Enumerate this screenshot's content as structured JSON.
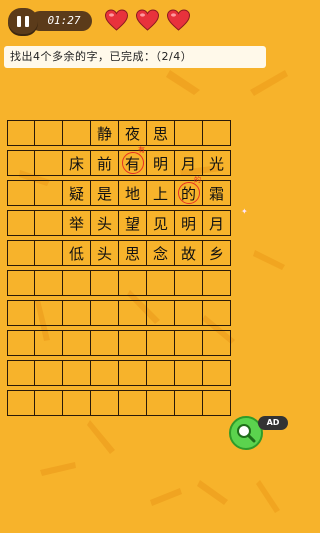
{
  "status_bar": {
    "timer": "01:27",
    "lives": 3
  },
  "instruction": "找出4个多余的字，已完成：（2/4）",
  "poem_grid": {
    "rows": [
      [
        "",
        "",
        "",
        "静",
        "夜",
        "思",
        "",
        ""
      ],
      [
        "",
        "",
        "床",
        "前",
        "有",
        "明",
        "月",
        "光"
      ],
      [
        "",
        "",
        "疑",
        "是",
        "地",
        "上",
        "的",
        "霜"
      ],
      [
        "",
        "",
        "举",
        "头",
        "望",
        "见",
        "明",
        "月"
      ],
      [
        "",
        "",
        "低",
        "头",
        "思",
        "念",
        "故",
        "乡"
      ],
      [
        "",
        "",
        "",
        "",
        "",
        "",
        "",
        ""
      ],
      [
        "",
        "",
        "",
        "",
        "",
        "",
        "",
        ""
      ],
      [
        "",
        "",
        "",
        "",
        "",
        "",
        "",
        ""
      ],
      [
        "",
        "",
        "",
        "",
        "",
        "",
        "",
        ""
      ],
      [
        "",
        "",
        "",
        "",
        "",
        "",
        "",
        ""
      ]
    ],
    "found_marks": [
      {
        "row": 1,
        "col": 4,
        "hint": "有"
      },
      {
        "row": 2,
        "col": 6,
        "hint": "的"
      }
    ]
  },
  "ad_badge": "AD",
  "colors": {
    "background": "#f7b32b",
    "accent_red": "#e53222",
    "button_dark": "#5b3b1a",
    "zoom_green": "#5bd34e"
  },
  "icons": {
    "pause": "pause-icon",
    "heart": "heart-icon",
    "zoom": "magnifier-icon"
  }
}
